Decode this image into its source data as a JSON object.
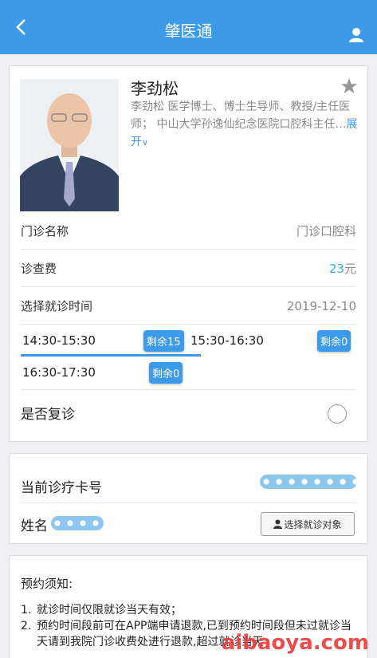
{
  "header": {
    "title": "肇医通"
  },
  "doctor": {
    "name": "李劲松",
    "bio": "李劲松 医学博士、博士生导师、教授/主任医师； 中山大学孙逸仙纪念医院口腔科主任…",
    "expand_label": "展开",
    "expand_arrow": "∨"
  },
  "clinic": {
    "name_label": "门诊名称",
    "name_value": "门诊口腔科",
    "fee_label": "诊查费",
    "fee_value": "23",
    "fee_unit": "元",
    "time_label": "选择就诊时间",
    "date_value": "2019-12-10"
  },
  "slots": [
    {
      "time": "14:30-15:30",
      "badge": "剩余15"
    },
    {
      "time": "15:30-16:30",
      "badge": "剩余0"
    },
    {
      "time": "16:30-17:30",
      "badge": "剩余0"
    }
  ],
  "revisit": {
    "label": "是否复诊"
  },
  "patient": {
    "card_label": "当前诊疗卡号",
    "name_label": "姓名",
    "choose_label": "选择就诊对象"
  },
  "notice": {
    "title": "预约须知:",
    "items": [
      {
        "num": "1.",
        "text": "就诊时间仅限就诊当天有效；"
      },
      {
        "num": "2.",
        "text": "预约时间段前可在APP端申请退款,已到预约时间段但未过就诊当天请到我院门诊收费处进行退款,超过就诊当天"
      }
    ]
  },
  "watermark": "aibaoya.com",
  "colors": {
    "accent": "#3d9ae8",
    "price": "#3aa9e0"
  }
}
